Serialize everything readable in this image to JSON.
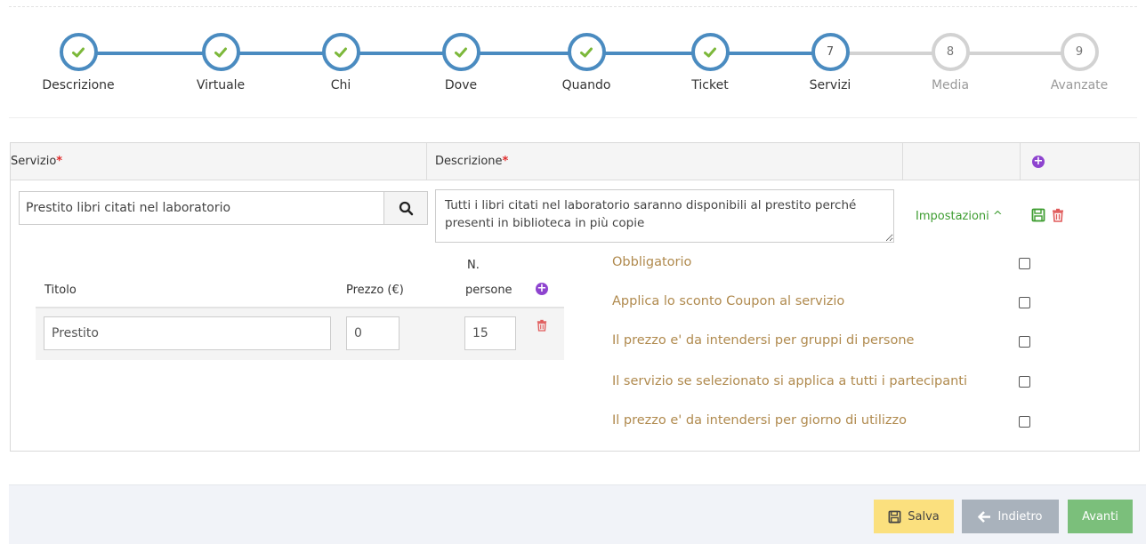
{
  "stepper": {
    "steps": [
      {
        "label": "Descrizione",
        "number": "1",
        "status": "done"
      },
      {
        "label": "Virtuale",
        "number": "2",
        "status": "done"
      },
      {
        "label": "Chi",
        "number": "3",
        "status": "done"
      },
      {
        "label": "Dove",
        "number": "4",
        "status": "done"
      },
      {
        "label": "Quando",
        "number": "5",
        "status": "done"
      },
      {
        "label": "Ticket",
        "number": "6",
        "status": "done"
      },
      {
        "label": "Servizi",
        "number": "7",
        "status": "current"
      },
      {
        "label": "Media",
        "number": "8",
        "status": "todo"
      },
      {
        "label": "Avanzate",
        "number": "9",
        "status": "todo"
      }
    ]
  },
  "services": {
    "header": {
      "servizio": "Servizio",
      "descrizione": "Descrizione",
      "required_mark": "*"
    },
    "service_value": "Prestito libri citati nel laboratorio",
    "description_value": "Tutti i libri citati nel laboratorio saranno disponibili al prestito perché presenti in biblioteca in più copie",
    "settings_label": "Impostazioni ^",
    "pricing": {
      "col_title": "Titolo",
      "col_price": "Prezzo (€)",
      "col_people_1": "N.",
      "col_people_2": "persone",
      "row": {
        "title": "Prestito",
        "price": "0",
        "people": "15"
      }
    },
    "options": [
      {
        "label": "Obbligatorio",
        "checked": false
      },
      {
        "label": "Applica lo sconto Coupon al servizio",
        "checked": false
      },
      {
        "label": "Il prezzo e' da intendersi per gruppi di persone",
        "checked": false
      },
      {
        "label": "Il servizio se selezionato si applica a tutti i partecipanti",
        "checked": false
      },
      {
        "label": "Il prezzo e' da intendersi per giorno di utilizzo",
        "checked": false
      }
    ]
  },
  "footer": {
    "save_label": "Salva",
    "back_label": "Indietro",
    "next_label": "Avanti"
  },
  "colors": {
    "step_done": "#4a8bc0",
    "check_green": "#7cb83a",
    "step_todo": "#d2d2d2",
    "option_text": "#b08a4e",
    "settings_green": "#3e9d31",
    "delete_red": "#e05a5a",
    "add_purple": "#8e44cf",
    "save_button": "#fbe07e",
    "back_button": "#a9b2bc",
    "next_button": "#7bbf7b"
  },
  "icons": [
    "check-icon",
    "search-icon",
    "add-icon",
    "save-icon",
    "trash-icon",
    "arrow-left-icon"
  ]
}
